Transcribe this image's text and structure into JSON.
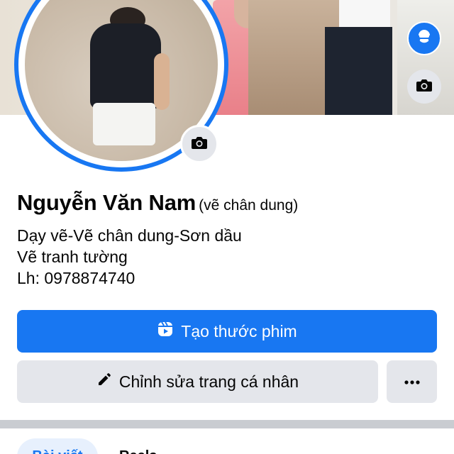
{
  "profile": {
    "name": "Nguyễn Văn Nam",
    "nickname": "(vẽ chân dung)",
    "bio_lines": [
      "Dạy vẽ-Vẽ chân dung-Sơn dầu",
      "Vẽ tranh tường",
      "Lh: 0978874740"
    ]
  },
  "actions": {
    "create_reel_label": "Tạo thước phim",
    "edit_profile_label": "Chỉnh sửa trang cá nhân",
    "more_label": "···"
  },
  "tabs": [
    {
      "label": "Bài viết",
      "active": true
    },
    {
      "label": "Reels",
      "active": false
    }
  ],
  "icons": {
    "avatar_camera": "camera-icon",
    "cover_camera": "camera-icon",
    "avatar_badge": "avatar-icon",
    "reel": "reel-icon",
    "edit": "pencil-icon",
    "more": "more-dots-icon"
  },
  "colors": {
    "accent": "#1877f2",
    "secondary_button": "#e4e6eb",
    "active_tab_bg": "#e7f0fd"
  }
}
